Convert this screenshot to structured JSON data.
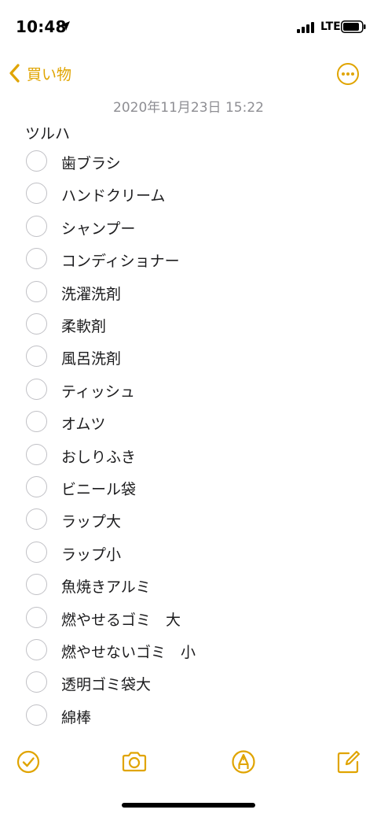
{
  "status_bar": {
    "time": "10:48",
    "network": "LTE"
  },
  "nav": {
    "back_label": "買い物"
  },
  "date": "2020年11月23日 15:22",
  "note_title": "ツルハ",
  "checklist": [
    "歯ブラシ",
    "ハンドクリーム",
    "シャンプー",
    "コンディショナー",
    "洗濯洗剤",
    "柔軟剤",
    "風呂洗剤",
    "ティッシュ",
    "オムツ",
    "おしりふき",
    "ビニール袋",
    "ラップ大",
    "ラップ小",
    "魚焼きアルミ",
    "燃やせるゴミ　大",
    "燃やせないゴミ　小",
    "透明ゴミ袋大",
    "綿棒"
  ],
  "colors": {
    "accent": "#e0a400",
    "checkbox_border": "#c0c0c5",
    "date_text": "#8e8e93"
  },
  "toolbar": {
    "icons": [
      "checklist-icon",
      "camera-icon",
      "markup-icon",
      "compose-icon"
    ]
  }
}
